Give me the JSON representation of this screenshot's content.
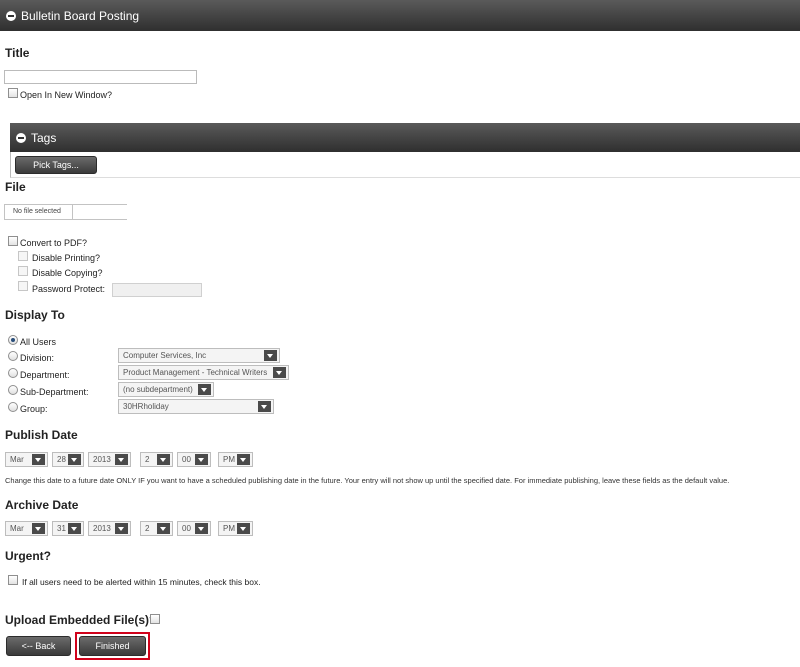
{
  "panel": {
    "title": "Bulletin Board Posting"
  },
  "title_section": {
    "heading": "Title",
    "open_new_window": "Open In New Window?"
  },
  "tags": {
    "title": "Tags",
    "pick_button": "Pick Tags..."
  },
  "file_section": {
    "heading": "File",
    "file_status": "No file selected",
    "convert_pdf": "Convert to PDF?",
    "disable_printing": "Disable Printing?",
    "disable_copying": "Disable Copying?",
    "password_protect": "Password Protect:"
  },
  "display_to": {
    "heading": "Display To",
    "options": [
      {
        "label": "All Users",
        "checked": true
      },
      {
        "label": "Division:",
        "value": "Computer Services, Inc"
      },
      {
        "label": "Department:",
        "value": "Product Management - Technical Writers"
      },
      {
        "label": "Sub-Department:",
        "value": "(no subdepartment)"
      },
      {
        "label": "Group:",
        "value": "30HRholiday"
      }
    ]
  },
  "publish_date": {
    "heading": "Publish Date",
    "month": "Mar",
    "day": "28",
    "year": "2013",
    "hour": "2",
    "minute": "00",
    "ampm": "PM",
    "hint": "Change this date to a future date ONLY IF you want to have a scheduled publishing date in the future. Your entry will not show up until the specified date. For immediate publishing, leave these fields as the default value."
  },
  "archive_date": {
    "heading": "Archive Date",
    "month": "Mar",
    "day": "31",
    "year": "2013",
    "hour": "2",
    "minute": "00",
    "ampm": "PM"
  },
  "urgent": {
    "heading": "Urgent?",
    "checkbox_label": "If all users need to be alerted within 15 minutes, check this box."
  },
  "upload": {
    "heading": "Upload Embedded File(s)?"
  },
  "actions": {
    "back": "<-- Back",
    "finished": "Finished"
  },
  "colors": {
    "header": "#3a3a3a",
    "highlight": "#d0021b"
  }
}
